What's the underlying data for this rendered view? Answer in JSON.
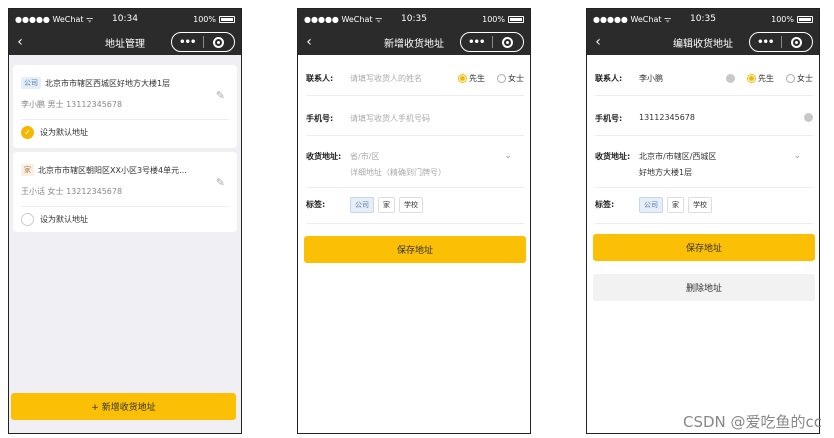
{
  "status": {
    "carrier": "●●●●● WeChat ᯤ",
    "battery": "100%"
  },
  "screens": [
    {
      "time": "10:34",
      "title": "地址管理",
      "addresses": [
        {
          "tag": "公司",
          "address": "北京市市辖区西城区好地方大楼1层",
          "contact": "李小鹏 男士  13112345678",
          "default_label": "设为默认地址"
        },
        {
          "tag": "家",
          "address": "北京市市辖区朝阳区XX小区3号楼4单元...",
          "contact": "王小话 女士  13212345678",
          "default_label": "设为默认地址"
        }
      ],
      "add_button": "+ 新增收货地址"
    },
    {
      "time": "10:35",
      "title": "新增收货地址",
      "contact_label": "联系人:",
      "contact_placeholder": "请填写收货人的姓名",
      "gender_male": "先生",
      "gender_female": "女士",
      "phone_label": "手机号:",
      "phone_placeholder": "请填写收货人手机号码",
      "address_label": "收货地址:",
      "region_placeholder": "省/市/区",
      "detail_placeholder": "详细地址（精确到门牌号）",
      "tags_label": "标签:",
      "tags": [
        "公司",
        "家",
        "学校"
      ],
      "save_button": "保存地址"
    },
    {
      "time": "10:35",
      "title": "编辑收货地址",
      "contact_label": "联系人:",
      "contact_value": "李小鹏",
      "gender_male": "先生",
      "gender_female": "女士",
      "phone_label": "手机号:",
      "phone_value": "13112345678",
      "address_label": "收货地址:",
      "region_value": "北京市/市辖区/西城区",
      "detail_value": "好地方大楼1层",
      "tags_label": "标签:",
      "tags": [
        "公司",
        "家",
        "学校"
      ],
      "save_button": "保存地址",
      "delete_button": "删除地址"
    }
  ],
  "watermark": "CSDN @爱吃鱼的cc",
  "colors": {
    "accent": "#fbbf06",
    "navbar": "#2b2b2b",
    "tag_company_bg": "#e6eef8"
  }
}
